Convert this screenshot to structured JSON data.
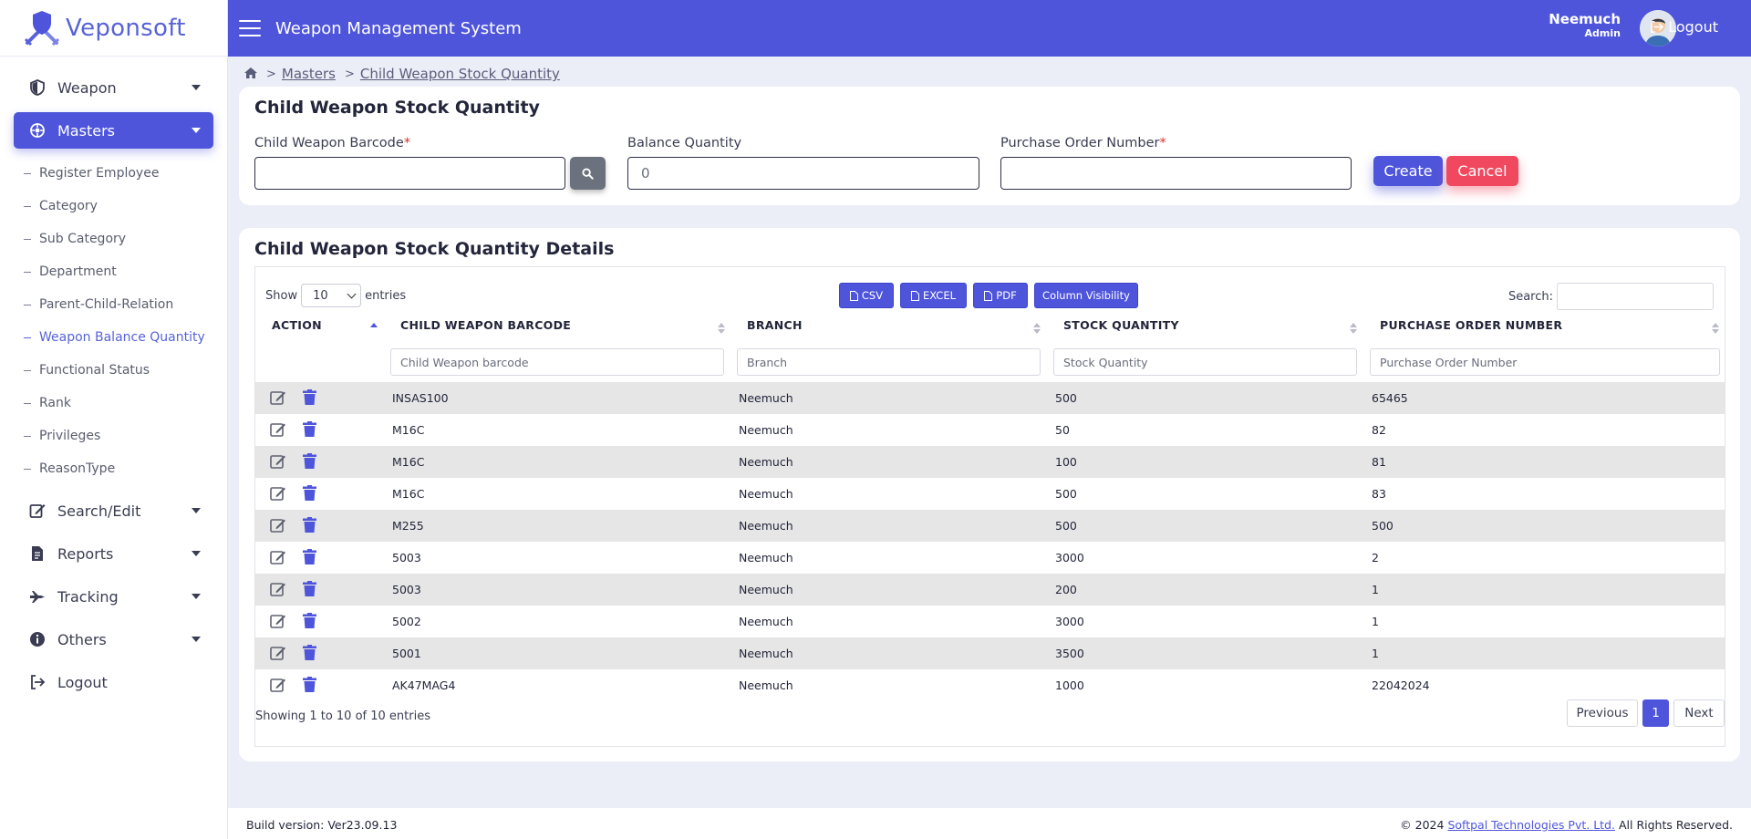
{
  "brand": {
    "name": "Veponsoft"
  },
  "colors": {
    "primary": "#4e55db",
    "danger": "#f0485e",
    "muted_button": "#6c727d",
    "row_stripe": "#e6e6e6"
  },
  "header": {
    "title": "Weapon Management System",
    "user_name": "Neemuch",
    "user_role": "Admin",
    "logout_label": "Logout"
  },
  "sidebar": {
    "items": [
      {
        "label": "Weapon",
        "icon": "shield-icon"
      },
      {
        "label": "Masters",
        "icon": "settings-gear-icon",
        "active": true
      },
      {
        "label": "Search/Edit",
        "icon": "edit-icon"
      },
      {
        "label": "Reports",
        "icon": "report-icon"
      },
      {
        "label": "Tracking",
        "icon": "plane-icon"
      },
      {
        "label": "Others",
        "icon": "info-icon"
      },
      {
        "label": "Logout",
        "icon": "logout-icon"
      }
    ],
    "sub_items": [
      "Register Employee",
      "Category",
      "Sub Category",
      "Department",
      "Parent-Child-Relation",
      "Weapon Balance Quantity",
      "Functional Status",
      "Rank",
      "Privileges",
      "ReasonType"
    ],
    "active_sub_index": 5
  },
  "breadcrumb": {
    "level1": "Masters",
    "level2": "Child Weapon Stock Quantity"
  },
  "form": {
    "title": "Child Weapon Stock Quantity",
    "barcode_label": "Child Weapon Barcode",
    "balance_label": "Balance Quantity",
    "balance_value": "0",
    "po_label": "Purchase Order Number",
    "required_mark": "*",
    "create_label": "Create",
    "cancel_label": "Cancel"
  },
  "details": {
    "title": "Child Weapon Stock Quantity Details",
    "show_label": "Show",
    "entries_label": "entries",
    "page_size": "10",
    "export_buttons": [
      "CSV",
      "EXCEL",
      "PDF",
      "Column Visibility"
    ],
    "search_label": "Search:",
    "columns": [
      "ACTION",
      "CHILD WEAPON BARCODE",
      "BRANCH",
      "STOCK QUANTITY",
      "PURCHASE ORDER NUMBER"
    ],
    "filter_placeholders": [
      "Child Weapon barcode",
      "Branch",
      "Stock Quantity",
      "Purchase Order Number"
    ],
    "rows": [
      {
        "barcode": "INSAS100",
        "branch": "Neemuch",
        "qty": "500",
        "po": "65465"
      },
      {
        "barcode": "M16C",
        "branch": "Neemuch",
        "qty": "50",
        "po": "82"
      },
      {
        "barcode": "M16C",
        "branch": "Neemuch",
        "qty": "100",
        "po": "81"
      },
      {
        "barcode": "M16C",
        "branch": "Neemuch",
        "qty": "500",
        "po": "83"
      },
      {
        "barcode": "M255",
        "branch": "Neemuch",
        "qty": "500",
        "po": "500"
      },
      {
        "barcode": "5003",
        "branch": "Neemuch",
        "qty": "3000",
        "po": "2"
      },
      {
        "barcode": "5003",
        "branch": "Neemuch",
        "qty": "200",
        "po": "1"
      },
      {
        "barcode": "5002",
        "branch": "Neemuch",
        "qty": "3000",
        "po": "1"
      },
      {
        "barcode": "5001",
        "branch": "Neemuch",
        "qty": "3500",
        "po": "1"
      },
      {
        "barcode": "AK47MAG4",
        "branch": "Neemuch",
        "qty": "1000",
        "po": "22042024"
      }
    ],
    "info": "Showing 1 to 10 of 10 entries",
    "prev_label": "Previous",
    "current_page": "1",
    "next_label": "Next"
  },
  "footer": {
    "build": "Build version: Ver23.09.13",
    "copyright_prefix": "© 2024",
    "company_link": "Softpal Technologies Pvt. Ltd.",
    "rights": "All Rights Reserved."
  }
}
